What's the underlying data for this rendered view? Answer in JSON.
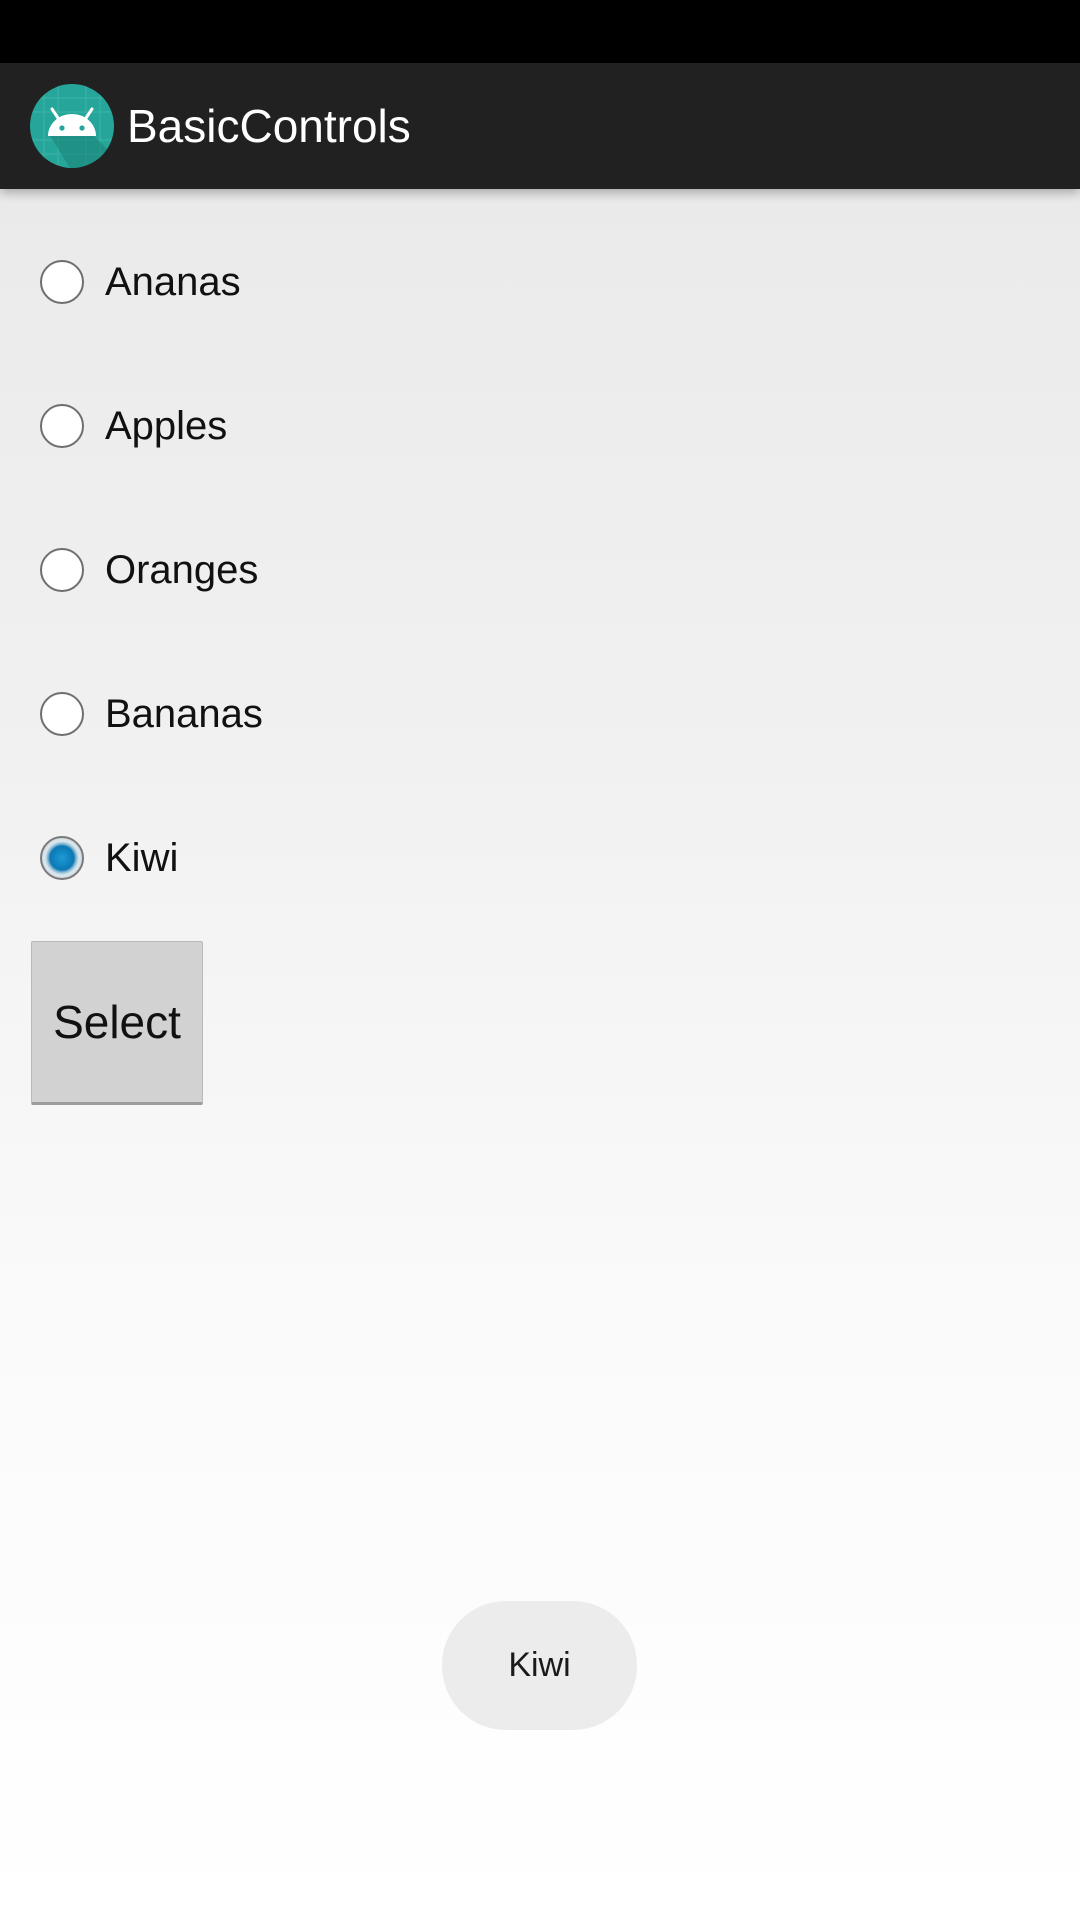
{
  "app": {
    "title": "BasicControls",
    "icon": "android-icon"
  },
  "radio_group": {
    "options": [
      {
        "label": "Ananas",
        "checked": false
      },
      {
        "label": "Apples",
        "checked": false
      },
      {
        "label": "Oranges",
        "checked": false
      },
      {
        "label": "Bananas",
        "checked": false
      },
      {
        "label": "Kiwi",
        "checked": true
      }
    ],
    "selected": "Kiwi"
  },
  "select_button": {
    "label": "Select"
  },
  "toast": {
    "text": "Kiwi"
  },
  "colors": {
    "status_bar": "#000000",
    "action_bar": "#212121",
    "app_icon_bg": "#26a69a",
    "radio_checked": "#0b78b5",
    "button_bg": "#d2d2d2",
    "toast_bg": "#ececec"
  }
}
